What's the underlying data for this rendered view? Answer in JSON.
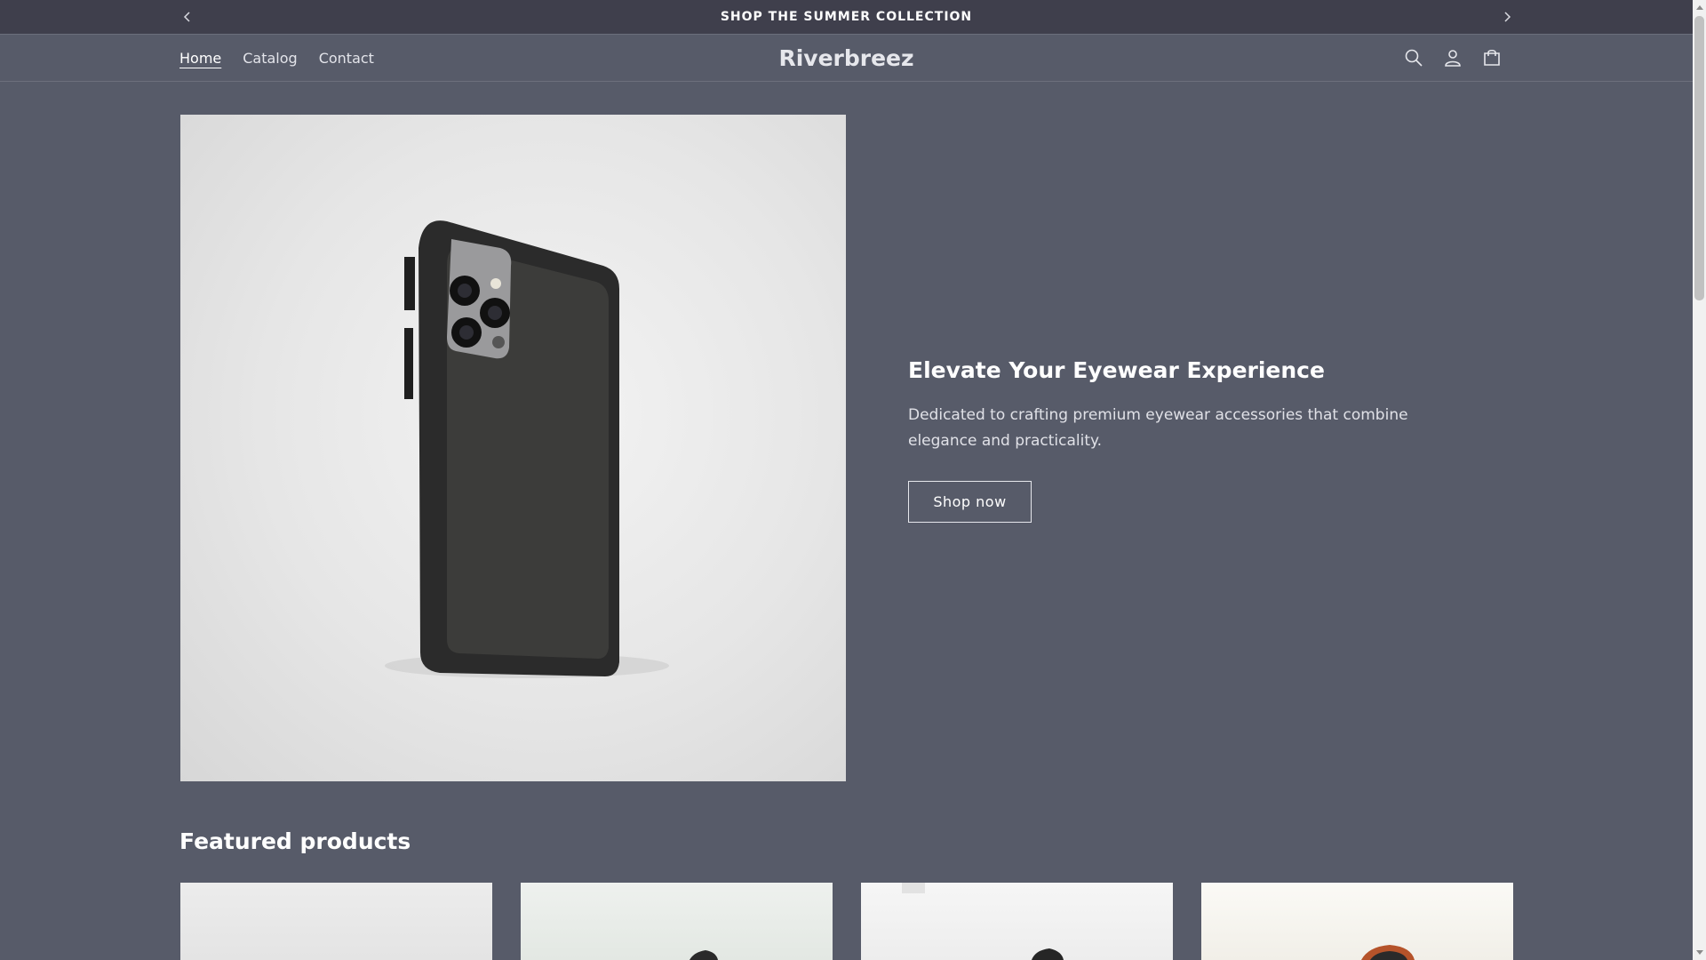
{
  "announcement": {
    "text": "SHOP THE SUMMER COLLECTION",
    "prev_icon": "chevron-left-icon",
    "next_icon": "chevron-right-icon"
  },
  "header": {
    "brand": "Riverbreez",
    "nav": [
      {
        "label": "Home",
        "active": true
      },
      {
        "label": "Catalog",
        "active": false
      },
      {
        "label": "Contact",
        "active": false
      }
    ],
    "icons": [
      "search-icon",
      "account-icon",
      "cart-icon"
    ]
  },
  "hero": {
    "image": "phone-case-product-photo",
    "title": "Elevate Your Eyewear Experience",
    "description": "Dedicated to crafting premium eyewear accessories that combine elegance and practicality.",
    "button_label": "Shop now"
  },
  "featured": {
    "title": "Featured products"
  },
  "colors": {
    "background": "#575b69",
    "announcement_bar": "#3f3f4c",
    "text": "#ffffff"
  }
}
